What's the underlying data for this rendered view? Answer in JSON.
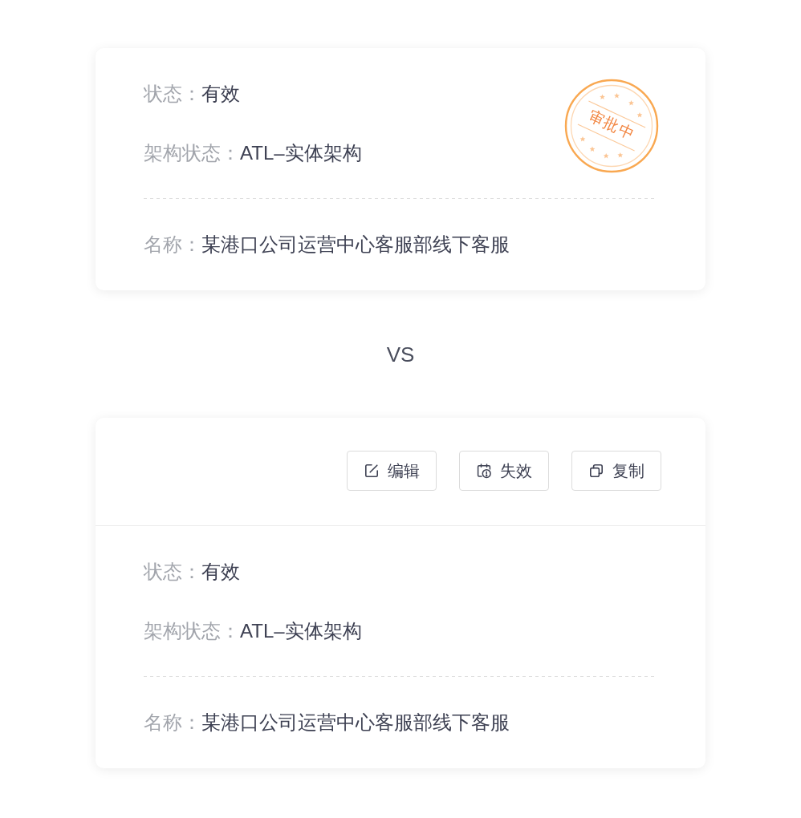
{
  "top_card": {
    "stamp": {
      "text": "审批中"
    },
    "groups": [
      {
        "fields": [
          {
            "label": "状态：",
            "value": "有效"
          },
          {
            "label": "架构状态：",
            "value": "ATL–实体架构"
          }
        ]
      },
      {
        "fields": [
          {
            "label": "名称：",
            "value": "某港口公司运营中心客服部线下客服"
          }
        ]
      }
    ]
  },
  "comparison_label": "VS",
  "bottom_card": {
    "actions": [
      {
        "kind": "edit",
        "label": "编辑"
      },
      {
        "kind": "expire",
        "label": "失效"
      },
      {
        "kind": "copy",
        "label": "复制"
      }
    ],
    "groups": [
      {
        "fields": [
          {
            "label": "状态：",
            "value": "有效"
          },
          {
            "label": "架构状态：",
            "value": "ATL–实体架构"
          }
        ]
      },
      {
        "fields": [
          {
            "label": "名称：",
            "value": "某港口公司运营中心客服部线下客服"
          }
        ]
      }
    ]
  }
}
